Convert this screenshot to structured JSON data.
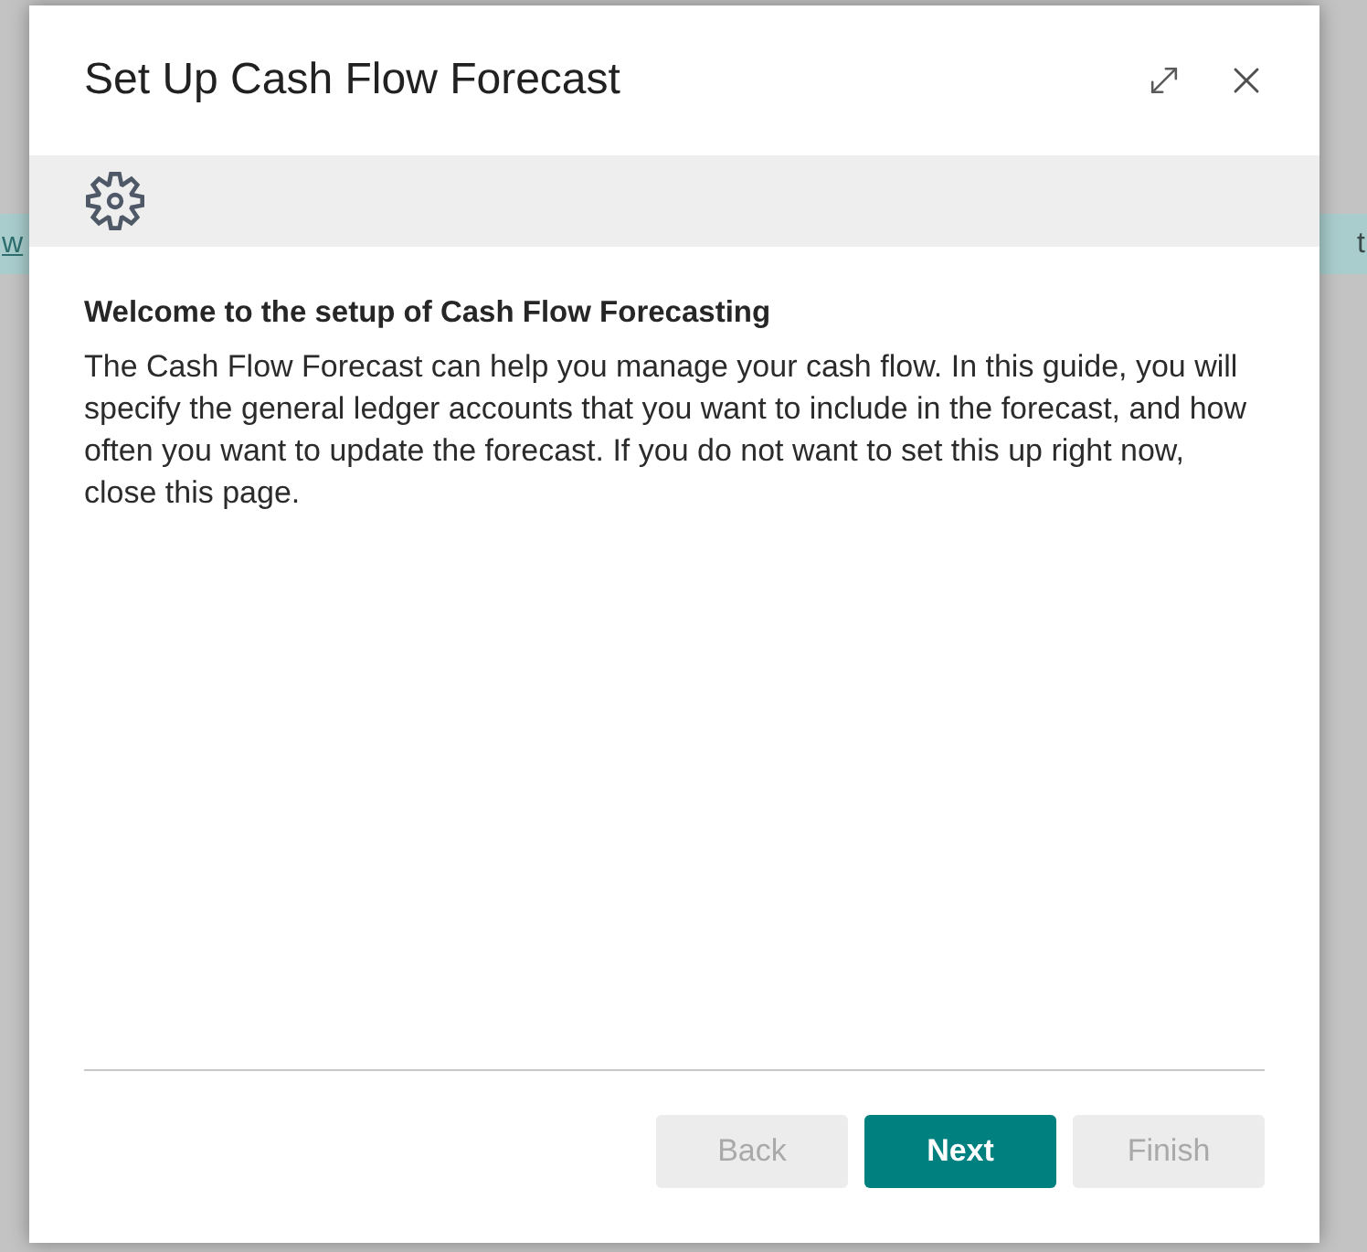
{
  "background": {
    "banner_left_text": "w",
    "banner_right_text": "t"
  },
  "dialog": {
    "title": "Set Up Cash Flow Forecast"
  },
  "step": {
    "heading": "Welcome to the setup of Cash Flow Forecasting",
    "body": "The Cash Flow Forecast can help you manage your cash flow. In this guide, you will specify the general ledger accounts that you want to include in the forecast, and how often you want to update the forecast. If you do not want to set this up right now, close this page."
  },
  "buttons": [
    {
      "label": "Back",
      "kind": "secondary",
      "disabled": true
    },
    {
      "label": "Next",
      "kind": "primary",
      "disabled": false
    },
    {
      "label": "Finish",
      "kind": "secondary",
      "disabled": true
    }
  ]
}
